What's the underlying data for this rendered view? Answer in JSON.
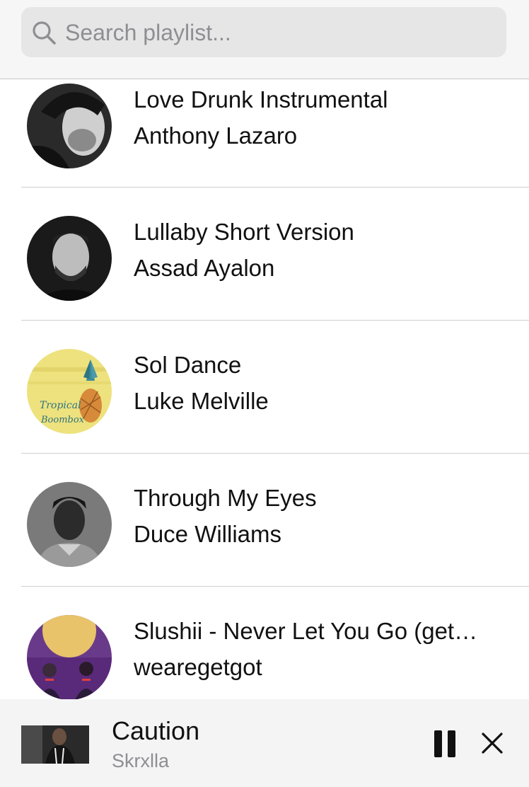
{
  "search": {
    "placeholder": "Search playlist..."
  },
  "tracks": [
    {
      "title": "Love Drunk Instrumental",
      "artist": "Anthony Lazaro"
    },
    {
      "title": "Lullaby Short Version",
      "artist": "Assad Ayalon"
    },
    {
      "title": "Sol Dance",
      "artist": "Luke Melville"
    },
    {
      "title": "Through My Eyes",
      "artist": "Duce Williams"
    },
    {
      "title": "Slushii - Never Let You Go (get…",
      "artist": "wearegetgot"
    }
  ],
  "album_art_text": {
    "line1": "Tropical",
    "line2": "Boombox"
  },
  "now_playing": {
    "title": "Caution",
    "artist": "Skrxlla"
  },
  "icons": {
    "search": "search-icon",
    "pause": "pause-icon",
    "close": "close-icon"
  },
  "colors": {
    "placeholder": "#8e8e93",
    "search_field": "#e6e6e7",
    "divider": "#cfcfcf"
  }
}
